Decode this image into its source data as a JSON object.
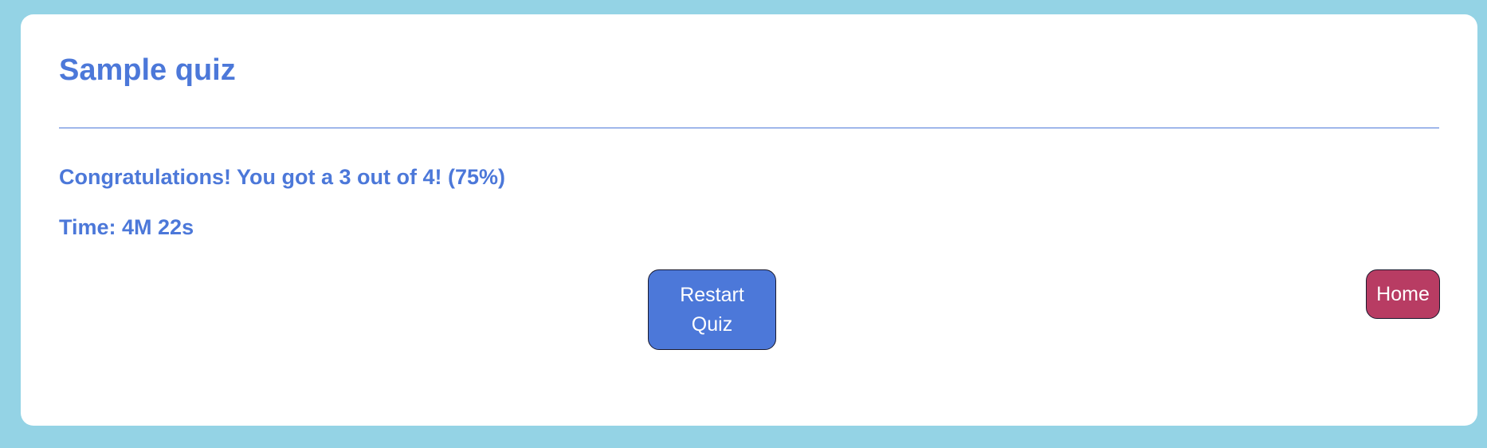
{
  "quiz": {
    "title": "Sample quiz",
    "result_text": "Congratulations! You got a 3 out of 4! (75%)",
    "time_text": "Time: 4M 22s"
  },
  "score": {
    "correct": 3,
    "total": 4,
    "percent": 75
  },
  "actions": {
    "restart_label": "Restart Quiz",
    "home_label": "Home"
  },
  "colors": {
    "background": "#94d3e5",
    "accent": "#4c78d9",
    "home_button": "#b83c63"
  }
}
